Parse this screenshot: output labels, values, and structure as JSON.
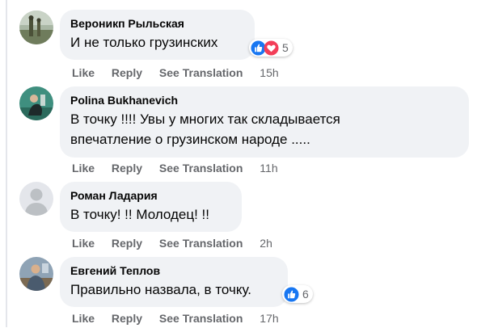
{
  "comments": [
    {
      "author": "Вероникп Рыльская",
      "text": "И не только грузинских",
      "reactions": [
        "like-icon",
        "love-icon"
      ],
      "reaction_count": "5",
      "actions": {
        "like": "Like",
        "reply": "Reply",
        "translate": "See Translation"
      },
      "time": "15h"
    },
    {
      "author": "Polina Bukhanevich",
      "text": "В точку !!!! Увы у многих так складывается\nвпечатление о грузинском народе .....",
      "actions": {
        "like": "Like",
        "reply": "Reply",
        "translate": "See Translation"
      },
      "time": "11h"
    },
    {
      "author": "Роман Ладария",
      "text": "В точку! !! Молодец! !!",
      "actions": {
        "like": "Like",
        "reply": "Reply",
        "translate": "See Translation"
      },
      "time": "2h"
    },
    {
      "author": "Евгений Теплов",
      "text": "Правильно назвала, в точку.",
      "reactions": [
        "like-icon"
      ],
      "reaction_count": "6",
      "actions": {
        "like": "Like",
        "reply": "Reply",
        "translate": "See Translation"
      },
      "time": "17h"
    }
  ],
  "colors": {
    "bubble": "#f0f2f5",
    "action_text": "#65676b",
    "like_blue": "#1877f2",
    "love_red": "#f33e58"
  }
}
